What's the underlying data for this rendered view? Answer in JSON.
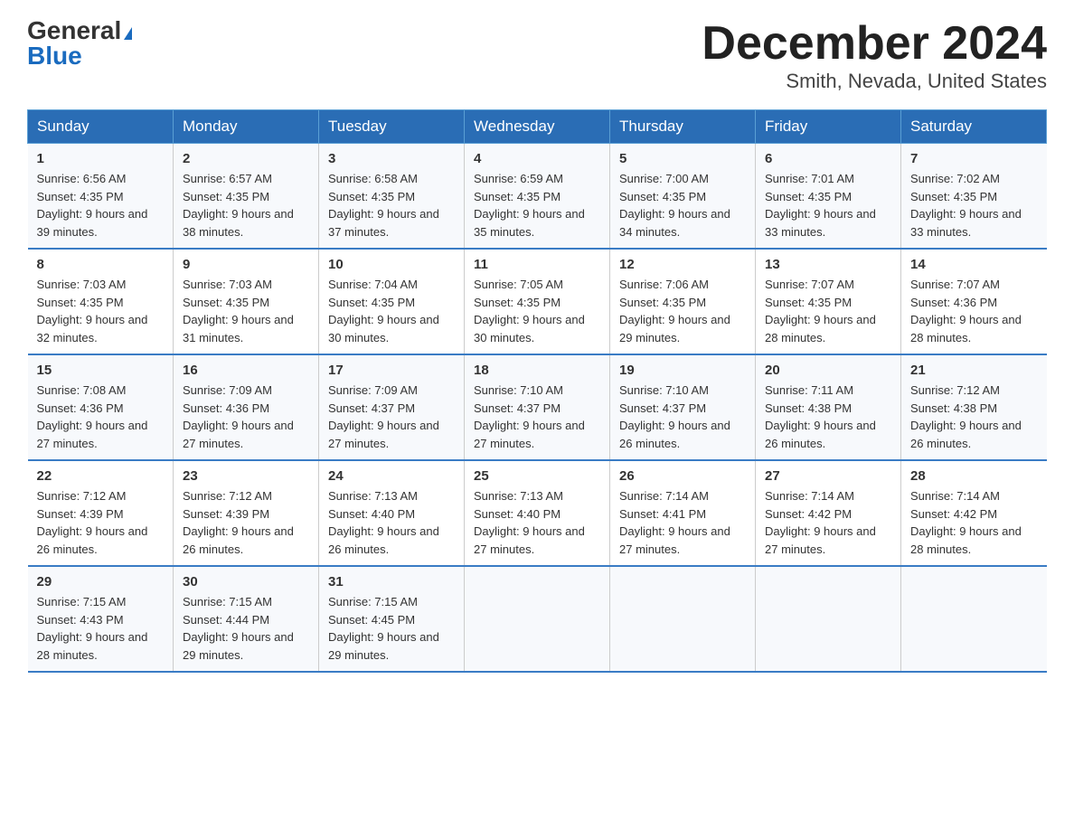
{
  "header": {
    "logo_general": "General",
    "logo_blue": "Blue",
    "month_title": "December 2024",
    "location": "Smith, Nevada, United States"
  },
  "weekdays": [
    "Sunday",
    "Monday",
    "Tuesday",
    "Wednesday",
    "Thursday",
    "Friday",
    "Saturday"
  ],
  "weeks": [
    [
      {
        "day": "1",
        "sunrise": "6:56 AM",
        "sunset": "4:35 PM",
        "daylight": "9 hours and 39 minutes."
      },
      {
        "day": "2",
        "sunrise": "6:57 AM",
        "sunset": "4:35 PM",
        "daylight": "9 hours and 38 minutes."
      },
      {
        "day": "3",
        "sunrise": "6:58 AM",
        "sunset": "4:35 PM",
        "daylight": "9 hours and 37 minutes."
      },
      {
        "day": "4",
        "sunrise": "6:59 AM",
        "sunset": "4:35 PM",
        "daylight": "9 hours and 35 minutes."
      },
      {
        "day": "5",
        "sunrise": "7:00 AM",
        "sunset": "4:35 PM",
        "daylight": "9 hours and 34 minutes."
      },
      {
        "day": "6",
        "sunrise": "7:01 AM",
        "sunset": "4:35 PM",
        "daylight": "9 hours and 33 minutes."
      },
      {
        "day": "7",
        "sunrise": "7:02 AM",
        "sunset": "4:35 PM",
        "daylight": "9 hours and 33 minutes."
      }
    ],
    [
      {
        "day": "8",
        "sunrise": "7:03 AM",
        "sunset": "4:35 PM",
        "daylight": "9 hours and 32 minutes."
      },
      {
        "day": "9",
        "sunrise": "7:03 AM",
        "sunset": "4:35 PM",
        "daylight": "9 hours and 31 minutes."
      },
      {
        "day": "10",
        "sunrise": "7:04 AM",
        "sunset": "4:35 PM",
        "daylight": "9 hours and 30 minutes."
      },
      {
        "day": "11",
        "sunrise": "7:05 AM",
        "sunset": "4:35 PM",
        "daylight": "9 hours and 30 minutes."
      },
      {
        "day": "12",
        "sunrise": "7:06 AM",
        "sunset": "4:35 PM",
        "daylight": "9 hours and 29 minutes."
      },
      {
        "day": "13",
        "sunrise": "7:07 AM",
        "sunset": "4:35 PM",
        "daylight": "9 hours and 28 minutes."
      },
      {
        "day": "14",
        "sunrise": "7:07 AM",
        "sunset": "4:36 PM",
        "daylight": "9 hours and 28 minutes."
      }
    ],
    [
      {
        "day": "15",
        "sunrise": "7:08 AM",
        "sunset": "4:36 PM",
        "daylight": "9 hours and 27 minutes."
      },
      {
        "day": "16",
        "sunrise": "7:09 AM",
        "sunset": "4:36 PM",
        "daylight": "9 hours and 27 minutes."
      },
      {
        "day": "17",
        "sunrise": "7:09 AM",
        "sunset": "4:37 PM",
        "daylight": "9 hours and 27 minutes."
      },
      {
        "day": "18",
        "sunrise": "7:10 AM",
        "sunset": "4:37 PM",
        "daylight": "9 hours and 27 minutes."
      },
      {
        "day": "19",
        "sunrise": "7:10 AM",
        "sunset": "4:37 PM",
        "daylight": "9 hours and 26 minutes."
      },
      {
        "day": "20",
        "sunrise": "7:11 AM",
        "sunset": "4:38 PM",
        "daylight": "9 hours and 26 minutes."
      },
      {
        "day": "21",
        "sunrise": "7:12 AM",
        "sunset": "4:38 PM",
        "daylight": "9 hours and 26 minutes."
      }
    ],
    [
      {
        "day": "22",
        "sunrise": "7:12 AM",
        "sunset": "4:39 PM",
        "daylight": "9 hours and 26 minutes."
      },
      {
        "day": "23",
        "sunrise": "7:12 AM",
        "sunset": "4:39 PM",
        "daylight": "9 hours and 26 minutes."
      },
      {
        "day": "24",
        "sunrise": "7:13 AM",
        "sunset": "4:40 PM",
        "daylight": "9 hours and 26 minutes."
      },
      {
        "day": "25",
        "sunrise": "7:13 AM",
        "sunset": "4:40 PM",
        "daylight": "9 hours and 27 minutes."
      },
      {
        "day": "26",
        "sunrise": "7:14 AM",
        "sunset": "4:41 PM",
        "daylight": "9 hours and 27 minutes."
      },
      {
        "day": "27",
        "sunrise": "7:14 AM",
        "sunset": "4:42 PM",
        "daylight": "9 hours and 27 minutes."
      },
      {
        "day": "28",
        "sunrise": "7:14 AM",
        "sunset": "4:42 PM",
        "daylight": "9 hours and 28 minutes."
      }
    ],
    [
      {
        "day": "29",
        "sunrise": "7:15 AM",
        "sunset": "4:43 PM",
        "daylight": "9 hours and 28 minutes."
      },
      {
        "day": "30",
        "sunrise": "7:15 AM",
        "sunset": "4:44 PM",
        "daylight": "9 hours and 29 minutes."
      },
      {
        "day": "31",
        "sunrise": "7:15 AM",
        "sunset": "4:45 PM",
        "daylight": "9 hours and 29 minutes."
      },
      null,
      null,
      null,
      null
    ]
  ],
  "labels": {
    "sunrise_prefix": "Sunrise: ",
    "sunset_prefix": "Sunset: ",
    "daylight_prefix": "Daylight: "
  }
}
